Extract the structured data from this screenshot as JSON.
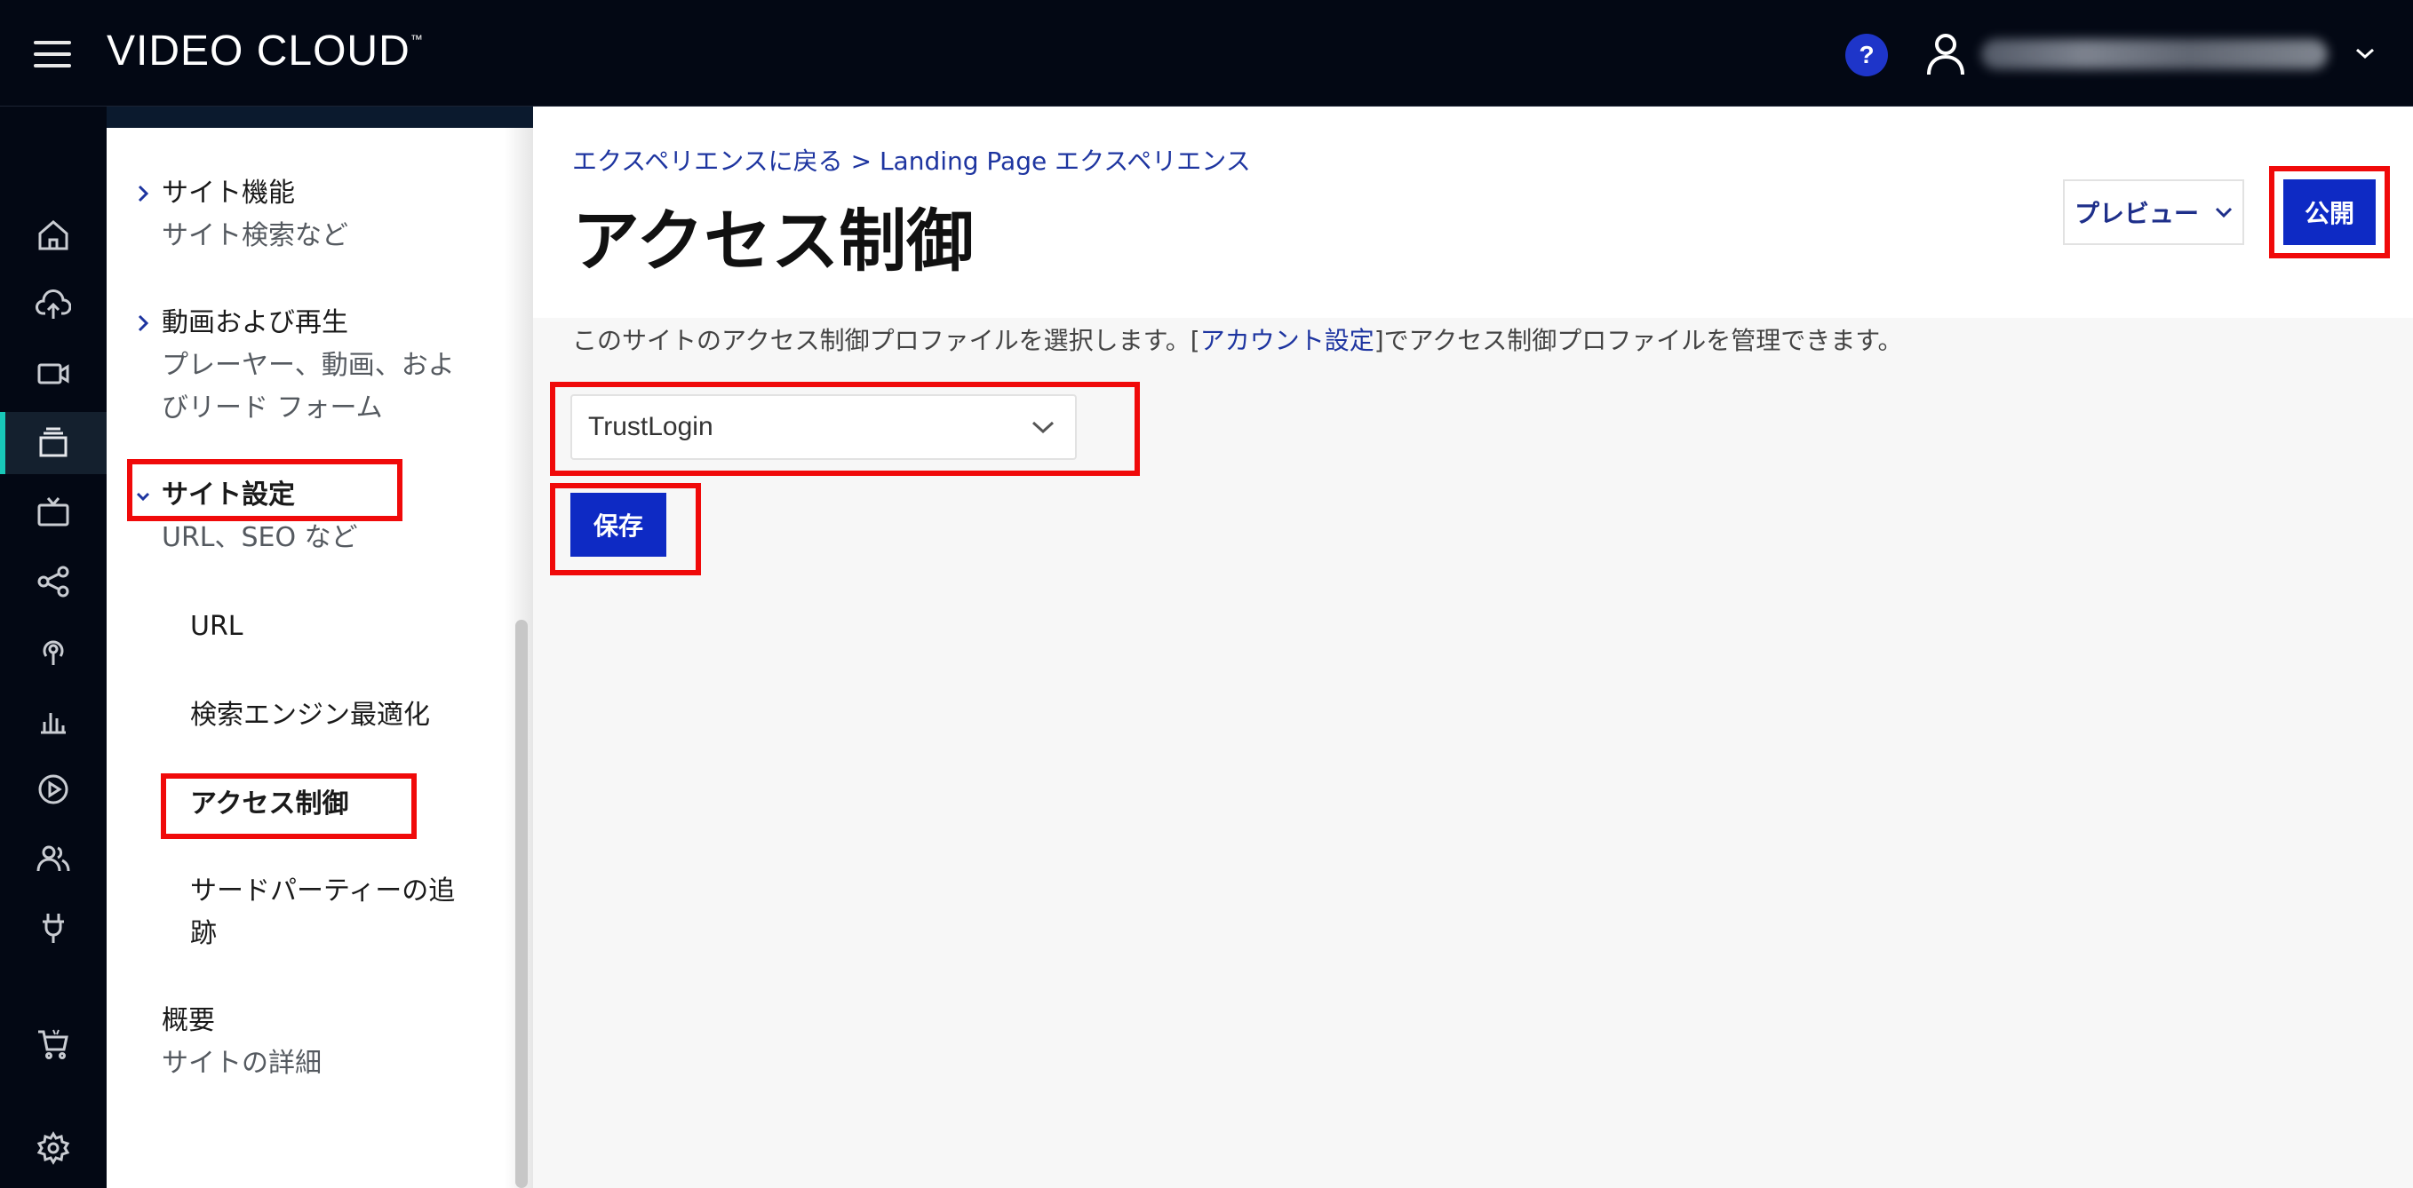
{
  "topbar": {
    "brand": "VIDEO CLOUD",
    "brand_tm": "™",
    "help_label": "?"
  },
  "rail": {
    "icons": [
      "home-icon",
      "upload-icon",
      "video-camera-icon",
      "gallery-icon",
      "tv-icon",
      "share-icon",
      "live-icon",
      "analytics-icon",
      "play-icon",
      "users-icon",
      "plugin-icon",
      "settings-icon",
      "cart-icon"
    ],
    "active": "gallery-icon",
    "accent_color": "#18c8b8"
  },
  "subnav": {
    "site_features": {
      "title": "サイト機能",
      "subtitle": "サイト検索など"
    },
    "video_playback": {
      "title": "動画および再生",
      "subtitle_line1": "プレーヤー、動画、およ",
      "subtitle_line2": "びリード フォーム"
    },
    "site_settings": {
      "title": "サイト設定",
      "subtitle": "URL、SEO など"
    },
    "children": {
      "url": "URL",
      "seo": "検索エンジン最適化",
      "access_control": "アクセス制御",
      "third_party_line1": "サードパーティーの追",
      "third_party_line2": "跡"
    },
    "overview": {
      "title": "概要",
      "subtitle": "サイトの詳細"
    }
  },
  "main": {
    "breadcrumb_back": "エクスペリエンスに戻る",
    "breadcrumb_sep": ">",
    "breadcrumb_current": "Landing Page エクスペリエンス",
    "title": "アクセス制御",
    "preview_label": "プレビュー",
    "publish_label": "公開",
    "description_before": "このサイトのアクセス制御プロファイルを選択します。[",
    "description_link": "アカウント設定",
    "description_after": "]でアクセス制御プロファイルを管理できます。",
    "profile_select_value": "TrustLogin",
    "save_label": "保存"
  },
  "colors": {
    "primary_button": "#0e2ac4",
    "link": "#1e35a0",
    "highlight": "#f00a0a",
    "topbar": "#030814"
  }
}
